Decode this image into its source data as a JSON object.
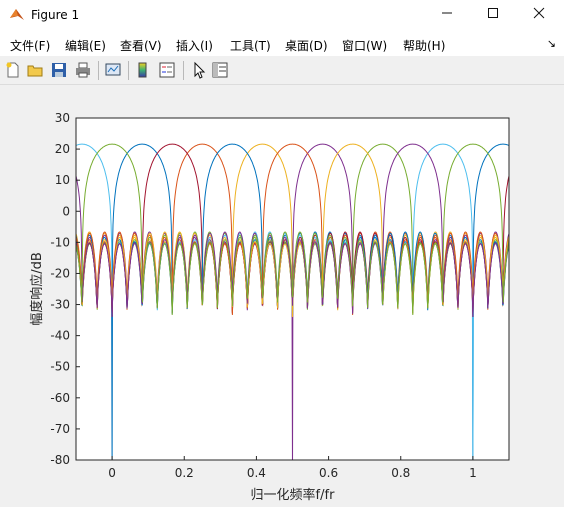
{
  "window": {
    "title": "Figure 1"
  },
  "menu": [
    "文件(F)",
    "编辑(E)",
    "查看(V)",
    "插入(I)",
    "工具(T)",
    "桌面(D)",
    "窗口(W)",
    "帮助(H)"
  ],
  "toolbar_icons": [
    "new-file-icon",
    "open-folder-icon",
    "save-icon",
    "print-icon",
    "link-plot-icon",
    "colorbar-icon",
    "legend-icon",
    "pointer-icon",
    "property-editor-icon"
  ],
  "chart_data": {
    "type": "line",
    "xlabel": "归一化频率f/fr",
    "ylabel": "幅度响应/dB",
    "xlim": [
      -0.1,
      1.1
    ],
    "ylim": [
      -80,
      30
    ],
    "xticks": [
      0,
      0.2,
      0.4,
      0.6,
      0.8,
      1
    ],
    "xtick_labels": [
      "0",
      "0.2",
      "0.4",
      "0.6",
      "0.8",
      "1"
    ],
    "yticks": [
      30,
      20,
      10,
      0,
      -10,
      -20,
      -30,
      -40,
      -50,
      -60,
      -70,
      -80
    ],
    "grid": false,
    "colors": [
      "#0072BD",
      "#D95319",
      "#EDB120",
      "#7E2F8E",
      "#77AC30",
      "#4DBEEE",
      "#A2142F"
    ],
    "series": [
      {
        "center": 0.0833,
        "peak": 21.6
      },
      {
        "center": 0.25,
        "peak": 21.6
      },
      {
        "center": 0.4167,
        "peak": 21.6
      },
      {
        "center": 0.5833,
        "peak": 21.6
      },
      {
        "center": 0.75,
        "peak": 21.6
      },
      {
        "center": 0.9167,
        "peak": 21.6
      },
      {
        "center": 0.1667,
        "peak": 21.6
      },
      {
        "center": 0.3333,
        "peak": 21.6
      },
      {
        "center": 0.5,
        "peak": 21.6
      },
      {
        "center": 0.6667,
        "peak": 21.6
      },
      {
        "center": 0.8333,
        "peak": 21.6
      },
      {
        "center": 0.0,
        "peak": 21.6
      }
    ],
    "mainlobe_halfwidth": 0.0833,
    "sidelobe_level": -8.5,
    "sidelobe_null_depth": -32,
    "sidelobe_spacing": 0.0417
  }
}
